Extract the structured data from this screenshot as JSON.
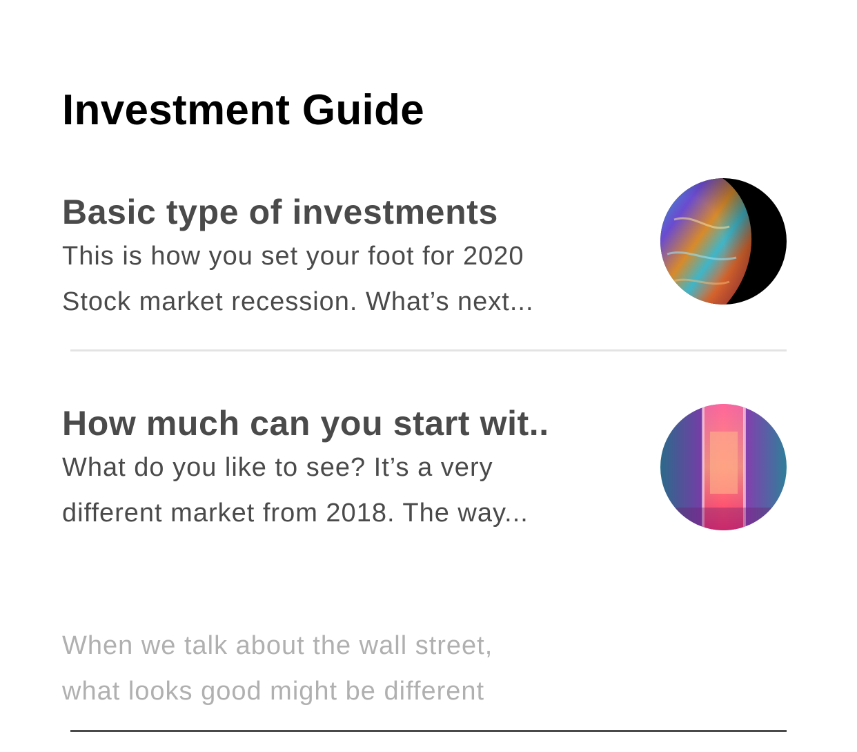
{
  "page": {
    "title": "Investment Guide"
  },
  "articles": [
    {
      "title": "Basic type of investments",
      "lines": [
        "This is how you set your foot for 2020",
        "Stock market recession. What’s next..."
      ],
      "image": "planet-image"
    },
    {
      "title": "How much can you start wit..",
      "lines": [
        "What do you like to see? It’s a very",
        "different market from 2018. The way..."
      ],
      "image": "neon-corridor-image"
    }
  ],
  "teaser": {
    "lines": [
      "When we talk about the wall street,",
      "what looks good might be different"
    ]
  },
  "colors": {
    "title": "#000000",
    "text": "#4a4a4a",
    "faded_text": "#b0b0b0",
    "divider_light": "#e3e3e3",
    "divider_dark": "#4a4a4a"
  }
}
